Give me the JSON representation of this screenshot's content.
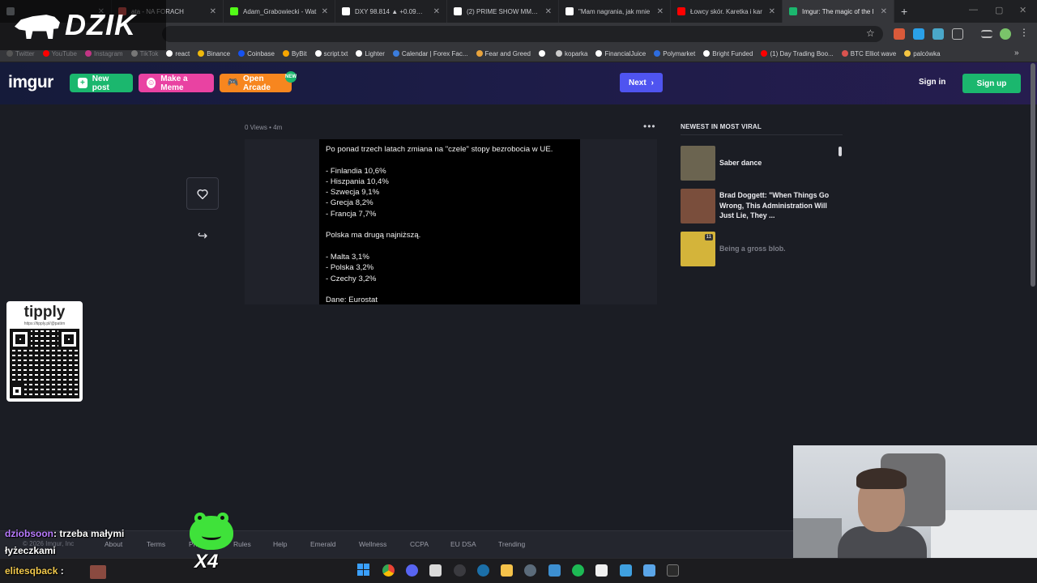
{
  "browser": {
    "tabs": [
      {
        "title": "",
        "icon": "circle",
        "color": "#9aa0a6",
        "active": false
      },
      {
        "title": "ata - NA FORACH",
        "icon": "speaker-icon",
        "color": "#d9534f",
        "active": false
      },
      {
        "title": "Adam_Grabowiecki - Wat",
        "icon": "k-icon",
        "color": "#53fc18",
        "active": false
      },
      {
        "title": "DXY 98.814 ▲ +0.09% Be",
        "icon": "tradingview-icon",
        "color": "#ffffff",
        "active": false
      },
      {
        "title": "(2) PRIME SHOW MMA or",
        "icon": "x-icon",
        "color": "#ffffff",
        "active": false
      },
      {
        "title": "\"Mam nagrania, jak mnie",
        "icon": "b-icon",
        "color": "#ffffff",
        "active": false
      },
      {
        "title": "Łowcy skór. Karetka i kar",
        "icon": "youtube-icon",
        "color": "#ff0000",
        "active": false
      },
      {
        "title": "Imgur: The magic of the I",
        "icon": "imgur-icon",
        "color": "#1bb76e",
        "active": true
      }
    ],
    "new_tab": "+",
    "bookmarks": [
      {
        "label": "Twitter",
        "color": "#555",
        "dim": true
      },
      {
        "label": "YouTube",
        "color": "#ff0000",
        "dim": true
      },
      {
        "label": "Instagram",
        "color": "#c13584",
        "dim": true
      },
      {
        "label": "TikTok",
        "color": "#777",
        "dim": true
      },
      {
        "label": "react",
        "color": "#ffffff",
        "dim": false
      },
      {
        "label": "Binance",
        "color": "#f0b90b",
        "dim": false
      },
      {
        "label": "Coinbase",
        "color": "#1652f0",
        "dim": false
      },
      {
        "label": "ByBit",
        "color": "#f7a600",
        "dim": false
      },
      {
        "label": "script.txt",
        "color": "#ffffff",
        "dim": false
      },
      {
        "label": "Lighter",
        "color": "#ffffff",
        "dim": false
      },
      {
        "label": "Calendar | Forex Fac...",
        "color": "#3b7ddd",
        "dim": false
      },
      {
        "label": "Fear and Greed",
        "color": "#e8a33c",
        "dim": false
      },
      {
        "label": "",
        "color": "#ffffff",
        "dim": false
      },
      {
        "label": "koparka",
        "color": "#cccccc",
        "dim": false
      },
      {
        "label": "FinancialJuice",
        "color": "#ffffff",
        "dim": false
      },
      {
        "label": "Polymarket",
        "color": "#2d6cdf",
        "dim": false
      },
      {
        "label": "Bright Funded",
        "color": "#ffffff",
        "dim": false
      },
      {
        "label": "(1) Day Trading Boo...",
        "color": "#ff0000",
        "dim": false
      },
      {
        "label": "BTC Elliot wave",
        "color": "#d9534f",
        "dim": false
      },
      {
        "label": "palcówka",
        "color": "#f5c542",
        "dim": false
      }
    ]
  },
  "overlay": {
    "logo_text": "DZIK"
  },
  "imgur": {
    "logo": "imgur",
    "new_post": "New post",
    "make_meme": "Make a Meme",
    "open_arcade": "Open Arcade",
    "arcade_badge": "NEW",
    "next": "Next",
    "sign_in": "Sign in",
    "sign_up": "Sign up",
    "accent_green": "#1bb76e",
    "accent_pink": "#e942a2",
    "accent_orange": "#f7861f",
    "accent_blue": "#4f54f0"
  },
  "post": {
    "meta": "0 Views • 4m",
    "lines": [
      "Po ponad trzech latach zmiana na \"czele\" stopy bezrobocia w UE.",
      "",
      "- Finlandia 10,6%",
      "- Hiszpania 10,4%",
      "- Szwecja 9,1%",
      "- Grecja 8,2%",
      "- Francja 7,7%",
      "",
      "Polska ma drugą najniższą.",
      "",
      "- Malta 3,1%",
      "- Polska 3,2%",
      "- Czechy 3,2%",
      "",
      "Dane: Eurostat"
    ]
  },
  "sidebar": {
    "title": "NEWEST IN MOST VIRAL",
    "items": [
      {
        "title": "Saber dance",
        "thumb": "#6b6450",
        "faded": false
      },
      {
        "title": "Brad Doggett: \"When Things Go Wrong, This Administration Will Just Lie, They ...",
        "thumb": "#7a4e3c",
        "faded": false
      },
      {
        "title": "Being a gross blob.",
        "thumb": "#d4b43a",
        "faded": true,
        "badge": "11"
      }
    ]
  },
  "tipply": {
    "logo": "tipply",
    "url": "https://tipply.pl/@patirn"
  },
  "footer": {
    "copyright": "© 2026 Imgur, Inc",
    "links": [
      "About",
      "Terms",
      "Privacy",
      "Rules",
      "Help",
      "Emerald",
      "Wellness",
      "CCPA",
      "EU DSA",
      "Trending"
    ]
  },
  "chat": {
    "messages": [
      {
        "user": "dziobsoon",
        "text": ": trzeba małymi"
      },
      {
        "user": "",
        "text": "łyżeczkami"
      },
      {
        "user": "elitesqback",
        "text": " :"
      }
    ],
    "emote_count": "X4"
  }
}
